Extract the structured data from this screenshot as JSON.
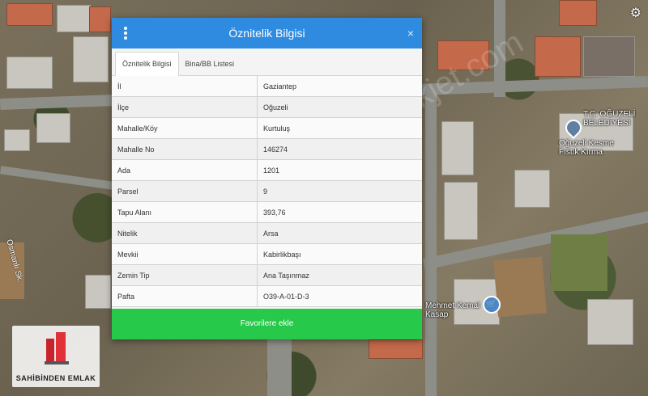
{
  "dialog": {
    "title": "Öznitelik Bilgisi",
    "close_label": "×",
    "tabs": [
      {
        "label": "Öznitelik Bilgisi",
        "active": true
      },
      {
        "label": "Bina/BB Listesi",
        "active": false
      }
    ],
    "attributes": [
      {
        "key": "İl",
        "value": "Gaziantep"
      },
      {
        "key": "İlçe",
        "value": "Oğuzeli"
      },
      {
        "key": "Mahalle/Köy",
        "value": "Kurtuluş"
      },
      {
        "key": "Mahalle No",
        "value": "146274"
      },
      {
        "key": "Ada",
        "value": "1201"
      },
      {
        "key": "Parsel",
        "value": "9"
      },
      {
        "key": "Tapu Alanı",
        "value": "393,76"
      },
      {
        "key": "Nitelik",
        "value": "Arsa"
      },
      {
        "key": "Mevkii",
        "value": "Kabirlikbaşı"
      },
      {
        "key": "Zemin Tip",
        "value": "Ana Taşınmaz"
      },
      {
        "key": "Pafta",
        "value": "O39-A-01-D-3"
      }
    ],
    "favorite_button": "Favorilere ekle"
  },
  "map": {
    "labels": {
      "municipality": "T.C. OĞUZELİ BELEDİYESİ",
      "poi": "Oğuzeli Kesme Fıstık Kırma",
      "shop": "Mehmet Kemal Kasap",
      "street": "Osmanlı Sk."
    },
    "watermark": "sahibinden emlakjet.com"
  },
  "logo": {
    "text": "SAHİBİNDEN EMLAK"
  },
  "colors": {
    "header": "#2f8be0",
    "favorite": "#27c94a"
  }
}
